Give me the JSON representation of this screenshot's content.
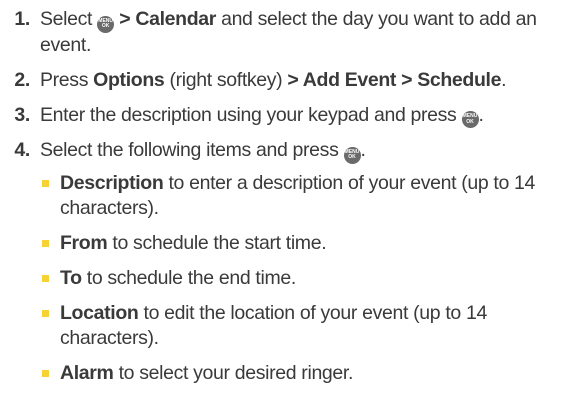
{
  "steps": [
    {
      "num": "1",
      "t1": "Select ",
      "key_top": "MENU",
      "key_bottom": "OK",
      "t2": " > Calendar",
      "t3": " and select the day you want to add an event."
    },
    {
      "num": "2",
      "t1": "Press ",
      "b1": "Options",
      "t2": " (right softkey) ",
      "b2": "> Add Event > Schedule",
      "t3": "."
    },
    {
      "num": "3",
      "t1": "Enter the description using your keypad and press ",
      "t2": "."
    },
    {
      "num": "4",
      "t1": "Select the following items and press ",
      "t2": "."
    }
  ],
  "sub_items": [
    {
      "bold": "Description",
      "text": " to enter a description of your event (up to 14 characters)."
    },
    {
      "bold": "From",
      "text": " to schedule the start time."
    },
    {
      "bold": "To",
      "text": " to schedule the end time."
    },
    {
      "bold": "Location",
      "text": " to edit the location of your event (up to 14 characters)."
    },
    {
      "bold": "Alarm",
      "text": " to select your desired ringer."
    }
  ],
  "colors": {
    "bullet": "#f7d233",
    "key": "#6a6a6a",
    "text": "#3a3a3a"
  }
}
